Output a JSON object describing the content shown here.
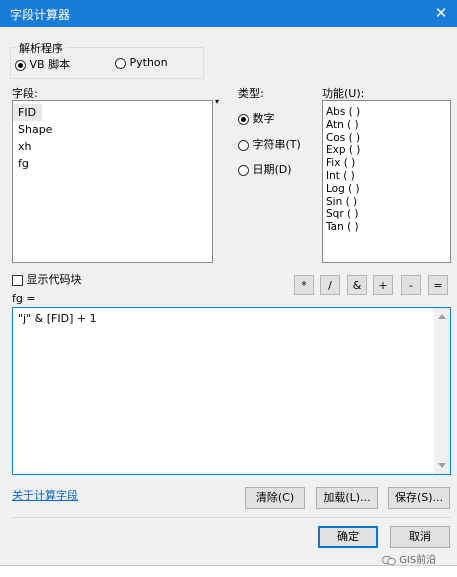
{
  "window": {
    "title": "字段计算器",
    "close_glyph": "✕"
  },
  "parser": {
    "label": "解析程序",
    "options": [
      {
        "label": "VB 脚本",
        "selected": true
      },
      {
        "label": "Python",
        "selected": false
      }
    ]
  },
  "fields": {
    "label": "字段:",
    "items": [
      "FID",
      "Shape",
      "xh",
      "fg"
    ],
    "selected": "FID"
  },
  "type": {
    "label": "类型:",
    "options": [
      {
        "label": "数字",
        "selected": true
      },
      {
        "label": "字符串(T)",
        "selected": false
      },
      {
        "label": "日期(D)",
        "selected": false
      }
    ]
  },
  "functions": {
    "label": "功能(U):",
    "items": [
      "Abs ( )",
      "Atn ( )",
      "Cos ( )",
      "Exp ( )",
      "Fix ( )",
      "Int ( )",
      "Log ( )",
      "Sin ( )",
      "Sqr ( )",
      "Tan ( )"
    ]
  },
  "codeblock": {
    "label": "显示代码块",
    "checked": false
  },
  "operators": [
    "*",
    "/",
    "&",
    "+",
    "-",
    "="
  ],
  "expression": {
    "label": "fg =",
    "value": "\"j\" & [FID] + 1"
  },
  "buttons": {
    "help_link": "关于计算字段",
    "clear": "清除(C)",
    "load": "加载(L)...",
    "save": "保存(S)...",
    "ok": "确定",
    "cancel": "取消"
  },
  "watermark": "GIS前沿",
  "colors": {
    "titlebar": "#1a7cd9",
    "dialog_bg": "#f0f0f0",
    "link": "#0066cc"
  }
}
